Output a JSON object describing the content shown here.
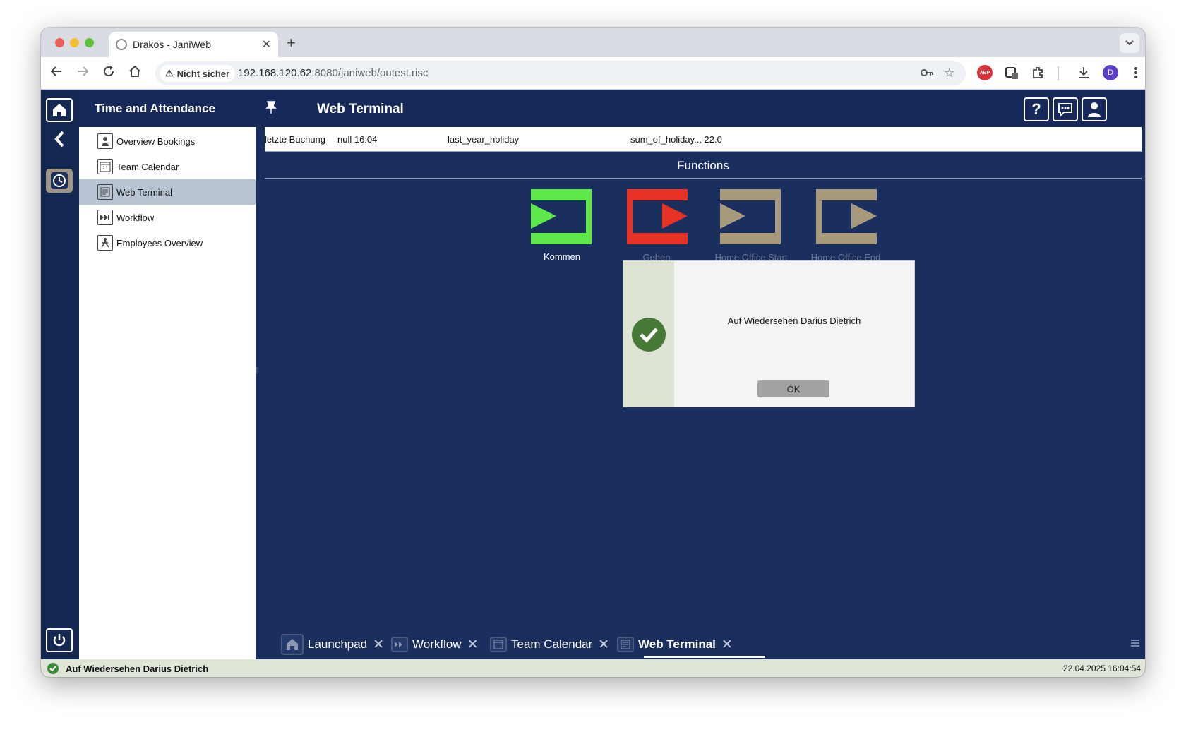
{
  "browser": {
    "tab_title": "Drakos - JaniWeb",
    "tab_close": "✕",
    "new_tab": "+",
    "security_label": "Nicht sicher",
    "url_host": "192.168.120.62",
    "url_rest": ":8080/janiweb/outest.risc",
    "profile_initial": "D",
    "abp_label": "ABP"
  },
  "header": {
    "section_title": "Time and Attendance",
    "page_title": "Web Terminal",
    "help_label": "?"
  },
  "sidebar": {
    "items": [
      {
        "label": "Overview Bookings"
      },
      {
        "label": "Team Calendar"
      },
      {
        "label": "Web Terminal",
        "active": true
      },
      {
        "label": "Workflow"
      },
      {
        "label": "Employees Overview"
      }
    ]
  },
  "info": {
    "label_last_booking": "letzte Buchung",
    "last_booking_value": "null 16:04",
    "last_year_holiday": "last_year_holiday",
    "sum_of_holiday": "sum_of_holiday... 22.0"
  },
  "functions": {
    "title": "Functions",
    "buttons": [
      {
        "label": "Kommen",
        "color": "#5ee84a"
      },
      {
        "label": "Gehen",
        "color": "#e53223"
      },
      {
        "label": "Home Office Start",
        "color": "#a8987c"
      },
      {
        "label": "Home Office End",
        "color": "#a8987c"
      }
    ]
  },
  "dialog": {
    "message": "Auf Wiedersehen Darius Dietrich",
    "ok_label": "OK"
  },
  "bottom_tabs": [
    {
      "label": "Launchpad"
    },
    {
      "label": "Workflow"
    },
    {
      "label": "Team Calendar"
    },
    {
      "label": "Web Terminal",
      "active": true
    }
  ],
  "bottom_tab_close": "✕",
  "status": {
    "message": "Auf Wiedersehen Darius Dietrich",
    "timestamp": "22.04.2025 16:04:54"
  },
  "colors": {
    "app_bg": "#1a2f5e",
    "accent_green": "#5ee84a",
    "accent_red": "#e53223",
    "accent_tan": "#a8987c",
    "success": "#467a36"
  }
}
